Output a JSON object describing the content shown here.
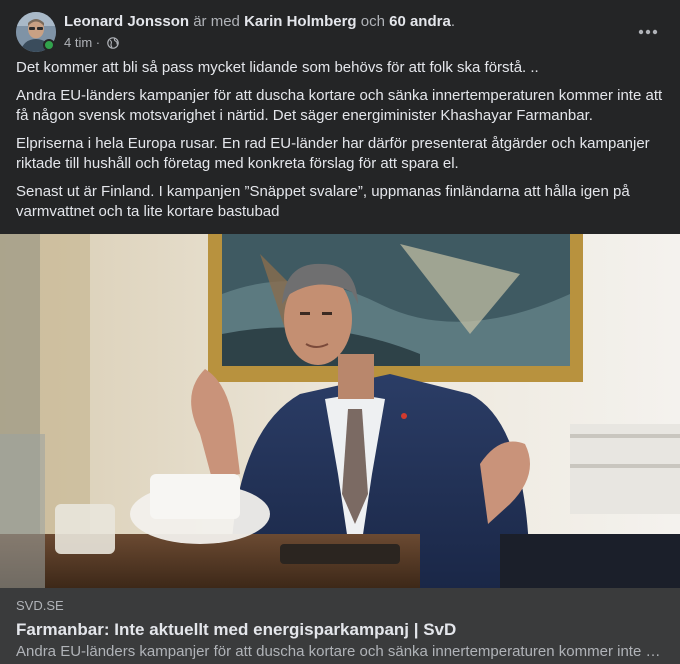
{
  "post": {
    "author": "Leonard Jonsson",
    "with_text": " är med ",
    "tagged": "Karin Holmberg",
    "and_text": " och ",
    "others": "60 andra",
    "period": ".",
    "time": "4 tim",
    "dot": " · ",
    "privacy_icon": "globe-icon",
    "more_icon": "more-horizontal-icon",
    "paragraphs": [
      "Det kommer att bli så pass mycket lidande som behövs för att folk ska förstå. ..",
      "Andra EU-länders kampanjer för att duscha kortare och sänka innertemperaturen kommer inte att få någon svensk motsvarighet i närtid. Det säger energiminister Khashayar Farmanbar.",
      "Elpriserna i hela Europa rusar. En rad EU-länder har därför presenterat åtgärder och kampanjer riktade till hushåll och företag med konkreta förslag för att spara el.",
      "Senast ut är Finland. I kampanjen ”Snäppet svalare”, uppmanas finländarna att hålla igen på varmvattnet och ta lite kortare bastubad"
    ]
  },
  "link": {
    "domain": "SVD.SE",
    "title": "Farmanbar: Inte aktuellt med energisparkampanj | SvD",
    "description": "Andra EU-länders kampanjer för att duscha kortare och sänka innertemperaturen kommer inte att få någon svensk motsvarighet i närtid."
  },
  "colors": {
    "background": "#242526",
    "link_box": "#3a3b3c",
    "text_primary": "#e4e6eb",
    "text_secondary": "#b0b3b8",
    "online": "#31a24c"
  }
}
